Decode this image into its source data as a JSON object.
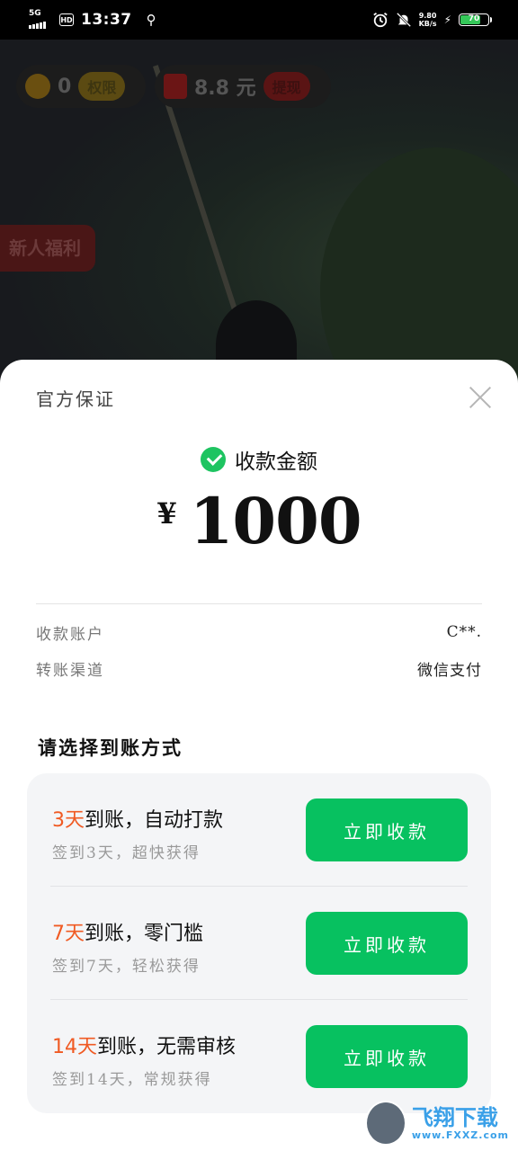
{
  "status_bar": {
    "network": "5G",
    "hd": "HD",
    "time": "13:37",
    "speed_value": "9.80",
    "speed_unit": "KB/s",
    "battery": "70"
  },
  "background_app": {
    "coin_count": "0",
    "coin_button": "权限",
    "cash_amount": "8.8 元",
    "cash_button": "提现",
    "newbie_banner": "新人福利"
  },
  "sheet": {
    "title": "官方保证",
    "amount_label": "收款金额",
    "currency": "¥",
    "amount": "1000",
    "account_label": "收款账户",
    "account_value": "C**.",
    "channel_label": "转账渠道",
    "channel_value": "微信支付",
    "choose_title": "请选择到账方式",
    "options": [
      {
        "days": "3天",
        "title": "到账，自动打款",
        "subtitle": "签到3天，超快获得",
        "button": "立即收款"
      },
      {
        "days": "7天",
        "title": "到账，零门槛",
        "subtitle": "签到7天，轻松获得",
        "button": "立即收款"
      },
      {
        "days": "14天",
        "title": "到账，无需审核",
        "subtitle": "签到14天，常规获得",
        "button": "立即收款"
      }
    ]
  },
  "watermark": {
    "name": "飞翔下载",
    "url": "www.FXXZ.com"
  },
  "colors": {
    "accent_green": "#07c160",
    "days_orange": "#f05a23",
    "wechat_green": "#1ec461"
  }
}
